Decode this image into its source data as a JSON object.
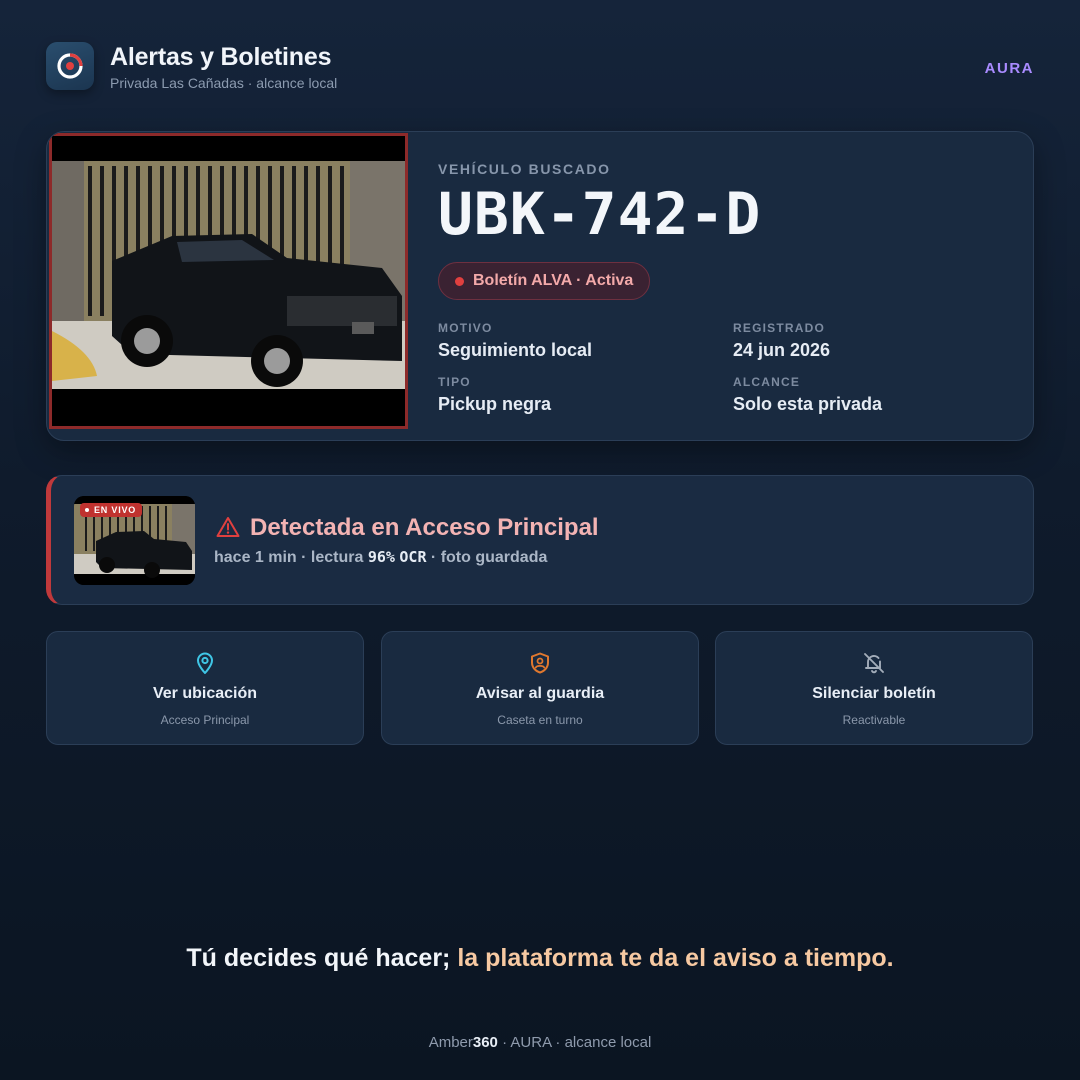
{
  "header": {
    "title": "Alertas y Boletines",
    "subtitle": "Privada Las Cañadas · alcance local",
    "badge": "AURA",
    "logo_icon": "gauge-ring-icon"
  },
  "vehicle": {
    "label": "VEHÍCULO BUSCADO",
    "plate": "UBK-742-D",
    "bulletin": "Boletín ALVA · Activa",
    "photo_icon": "black-pickup-truck-photo",
    "fields": {
      "motivo": {
        "label": "MOTIVO",
        "value": "Seguimiento local"
      },
      "registrado": {
        "label": "REGISTRADO",
        "value": "24 jun 2026"
      },
      "tipo": {
        "label": "TIPO",
        "value": "Pickup negra"
      },
      "alcance": {
        "label": "ALCANCE",
        "value": "Solo esta privada"
      }
    }
  },
  "detection": {
    "live": "EN VIVO",
    "title": "Detectada en Acceso Principal",
    "meta_prefix": "hace 1 min · lectura ",
    "confidence": "96%",
    "ocr": "OCR",
    "meta_suffix": " · foto guardada",
    "accent_color": "#c0393b"
  },
  "actions": [
    {
      "title": "Ver ubicación",
      "subtitle": "Acceso Principal",
      "icon": "map-pin-icon",
      "color": "#3fc6e6"
    },
    {
      "title": "Avisar al guardia",
      "subtitle": "Caseta en turno",
      "icon": "shield-user-icon",
      "color": "#e0782e"
    },
    {
      "title": "Silenciar boletín",
      "subtitle": "Reactivable",
      "icon": "bell-off-icon",
      "color": "#a3adba"
    }
  ],
  "tagline": {
    "part1": "Tú decides qué hacer; ",
    "part2": "la plataforma te da el aviso a tiempo."
  },
  "footer": {
    "brand_prefix": "Amber",
    "brand_number": "360",
    "rest": " · AURA · alcance local"
  },
  "colors": {
    "accent_purple": "#a98bff",
    "alert_red": "#e0403f",
    "tagline_highlight": "#f7c9a2"
  }
}
